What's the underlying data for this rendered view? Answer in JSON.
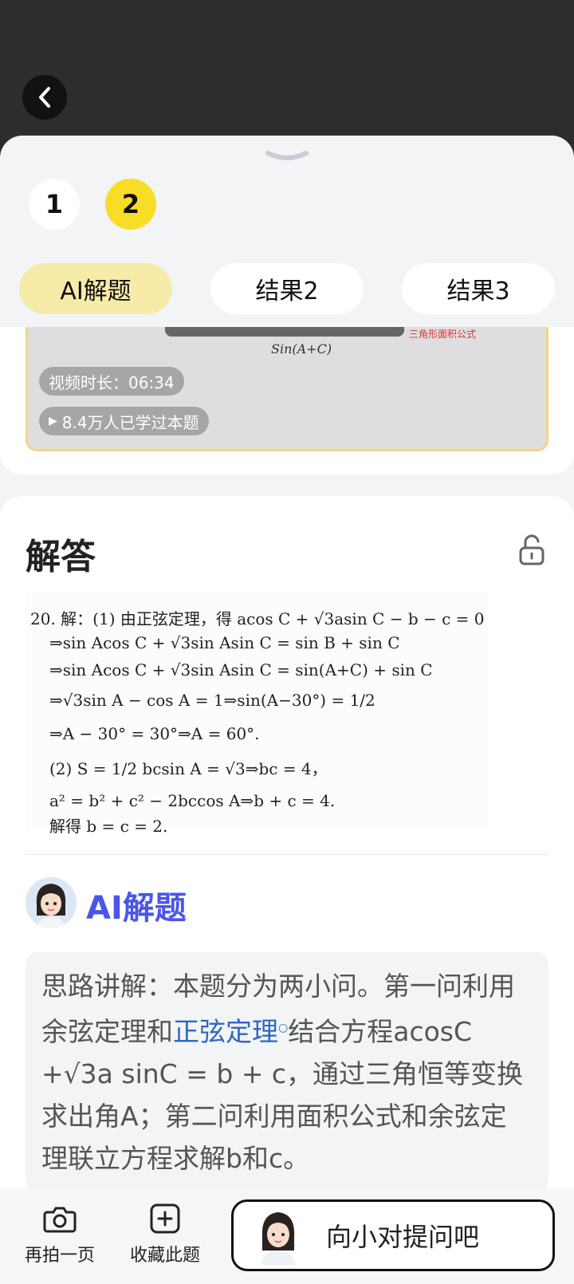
{
  "tabs": {
    "numbers": [
      "1",
      "2"
    ],
    "results": [
      "AI解题",
      "结果2",
      "结果3"
    ]
  },
  "video": {
    "formula_snippet": "Sin(A+C)",
    "red_note": "三角形面积公式",
    "duration": "视频时长：06:34",
    "learners": "8.4万人已学过本题"
  },
  "answer": {
    "title": "解答",
    "solution_lines": [
      "20. 解：(1) 由正弦定理，得 acos C + √3asin C − b − c = 0",
      "⇒sin Acos C + √3sin Asin C = sin B + sin C",
      "⇒sin Acos C + √3sin Asin C = sin(A+C) + sin C",
      "⇒√3sin A − cos A = 1⇒sin(A−30°) = 1/2",
      "⇒A − 30° = 30°⇒A = 60°.",
      "(2) S = 1/2 bcsin A = √3⇒bc = 4，",
      "a² = b² + c² − 2bccos A⇒b + c = 4.",
      "解得 b = c = 2."
    ]
  },
  "ai": {
    "title": "AI解题",
    "text_before": "思路讲解：本题分为两小问。第一问利用余弦定理和",
    "link": "正弦定理",
    "text_after": "结合方程acosC +√3a sinC = b + c，通过三角恒等变换求出角A；第二问利用面积公式和余弦定理联立方程求解b和c。"
  },
  "bottom": {
    "retake": "再拍一页",
    "favorite": "收藏此题",
    "ask": "向小对提问吧"
  }
}
